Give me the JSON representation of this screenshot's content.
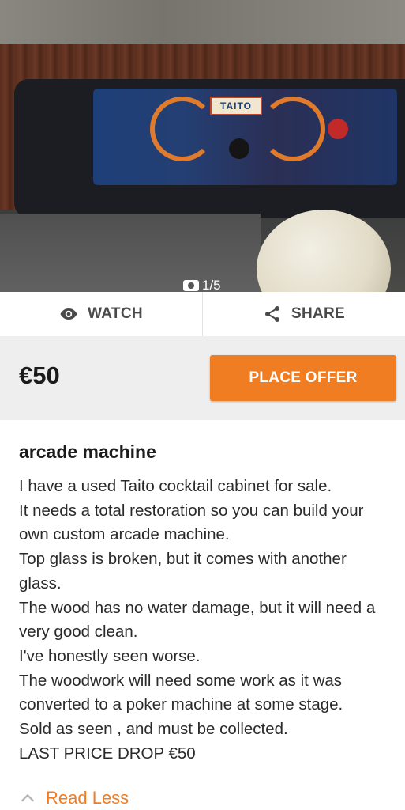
{
  "photo": {
    "badge_text": "TAITO",
    "counter": "1/5"
  },
  "actions": {
    "watch_label": "WATCH",
    "share_label": "SHARE"
  },
  "listing": {
    "price": "€50",
    "offer_label": "PLACE OFFER",
    "title": "arcade machine",
    "description_lines": [
      "I have a used Taito cocktail cabinet for sale.",
      "It needs a total restoration so you can build your",
      "own custom arcade machine.",
      "Top glass is broken, but it comes with another",
      "glass.",
      "The wood has no water damage, but it will need a",
      "very good clean.",
      "I've honestly seen worse.",
      "The woodwork will need some work as it was",
      "converted to a poker machine at some stage.",
      "Sold as seen , and must be collected.",
      "LAST PRICE DROP €50"
    ],
    "read_less_label": "Read Less"
  },
  "colors": {
    "accent": "#f07d22",
    "price_bar_bg": "#eeeeee"
  },
  "icons": [
    "camera-icon",
    "eye-icon",
    "share-icon",
    "chevron-up-icon"
  ]
}
